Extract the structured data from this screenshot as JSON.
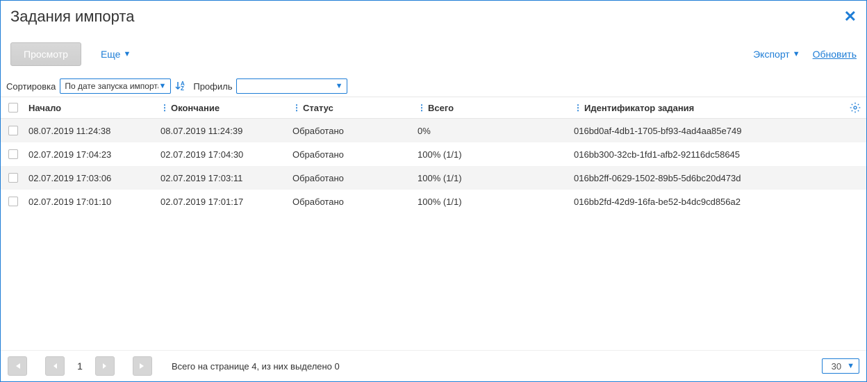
{
  "window": {
    "title": "Задания импорта"
  },
  "toolbar": {
    "view": "Просмотр",
    "more": "Еще",
    "export": "Экспорт",
    "refresh": "Обновить"
  },
  "filter": {
    "sort_label": "Сортировка",
    "sort_value": "По дате запуска импорта",
    "profile_label": "Профиль",
    "profile_value": ""
  },
  "columns": {
    "start": "Начало",
    "end": "Окончание",
    "status": "Статус",
    "total": "Всего",
    "id": "Идентификатор задания"
  },
  "rows": [
    {
      "start": "08.07.2019 11:24:38",
      "end": "08.07.2019 11:24:39",
      "status": "Обработано",
      "total": "0%",
      "id": "016bd0af-4db1-1705-bf93-4ad4aa85e749"
    },
    {
      "start": "02.07.2019 17:04:23",
      "end": "02.07.2019 17:04:30",
      "status": "Обработано",
      "total": "100% (1/1)",
      "id": "016bb300-32cb-1fd1-afb2-92116dc58645"
    },
    {
      "start": "02.07.2019 17:03:06",
      "end": "02.07.2019 17:03:11",
      "status": "Обработано",
      "total": "100% (1/1)",
      "id": "016bb2ff-0629-1502-89b5-5d6bc20d473d"
    },
    {
      "start": "02.07.2019 17:01:10",
      "end": "02.07.2019 17:01:17",
      "status": "Обработано",
      "total": "100% (1/1)",
      "id": "016bb2fd-42d9-16fa-be52-b4dc9cd856a2"
    }
  ],
  "pager": {
    "page": "1",
    "status": "Всего на странице 4, из них выделено 0",
    "pagesize": "30"
  }
}
